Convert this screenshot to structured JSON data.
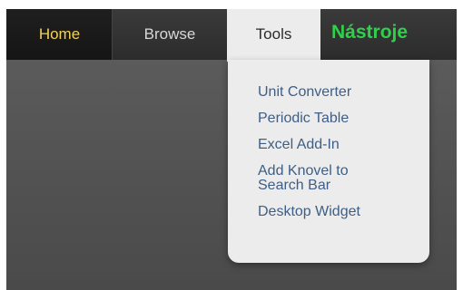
{
  "nav": {
    "items": [
      {
        "label": "Home",
        "state": "default"
      },
      {
        "label": "Browse",
        "state": "default"
      },
      {
        "label": "Tools",
        "state": "open"
      }
    ],
    "brand_label": "Nástroje"
  },
  "tools_menu": {
    "items": [
      {
        "label": "Unit Converter"
      },
      {
        "label": "Periodic Table"
      },
      {
        "label": "Excel Add-In"
      },
      {
        "label": "Add Knovel to\nSearch Bar"
      },
      {
        "label": "Desktop Widget"
      }
    ]
  },
  "colors": {
    "home_text": "#f4d15b",
    "brand_text": "#2fd04a",
    "menu_link": "#3e5e86",
    "menu_bg": "#ececec"
  }
}
